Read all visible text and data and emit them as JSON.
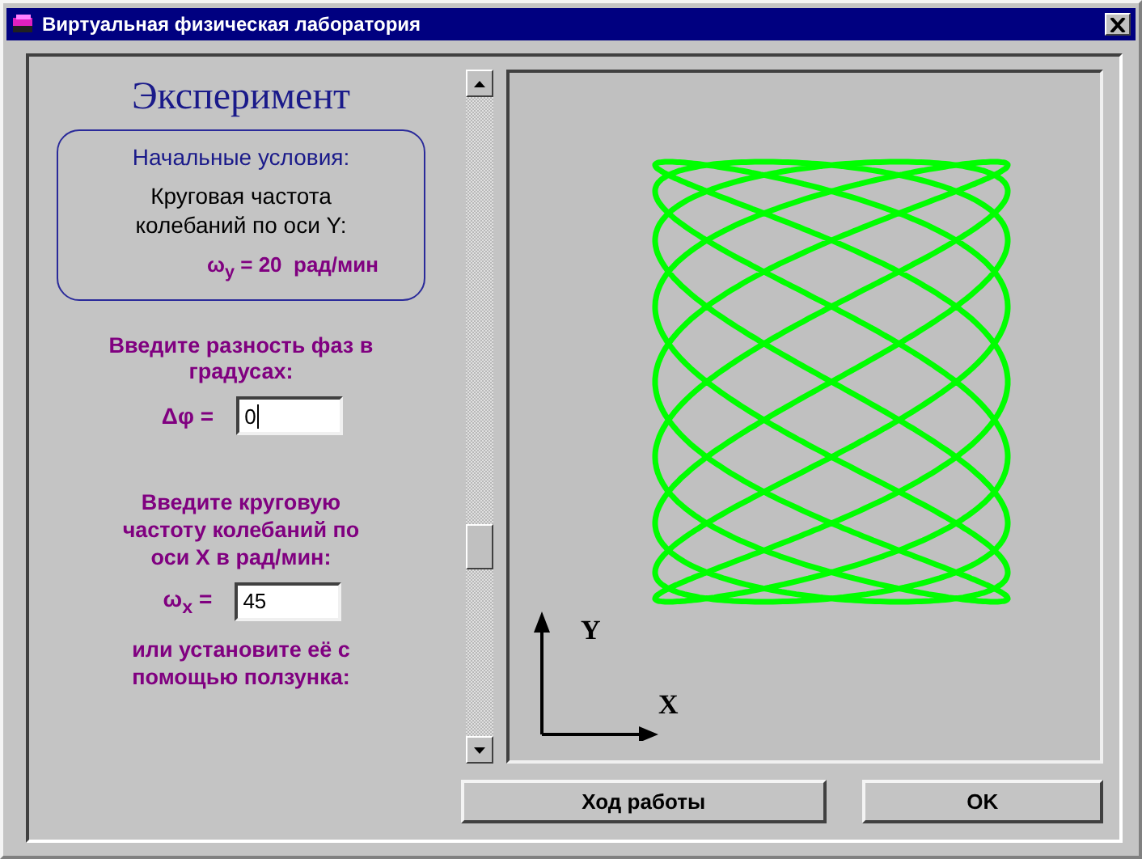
{
  "window": {
    "title": "Виртуальная физическая лаборатория"
  },
  "heading": "Эксперимент",
  "initial_conditions": {
    "title": "Начальные условия:",
    "label": "Круговая частота колебаний по оси Y:",
    "value": "ω$_{y}$ = 20  рад/мин"
  },
  "phase": {
    "prompt": "Введите разность фаз в градусах:",
    "label": "Δφ =",
    "value": "0"
  },
  "frequency_x": {
    "prompt": "Введите круговую частоту колебаний по оси X в рад/мин:",
    "label": "ω$_{x}$ =",
    "value": "45",
    "hint": "или установите её с помощью ползунка:"
  },
  "slider": {
    "level": 0.72
  },
  "plot": {
    "y_label": "Y",
    "x_label": "X"
  },
  "buttons": [
    "Ход работы",
    "OK"
  ]
}
